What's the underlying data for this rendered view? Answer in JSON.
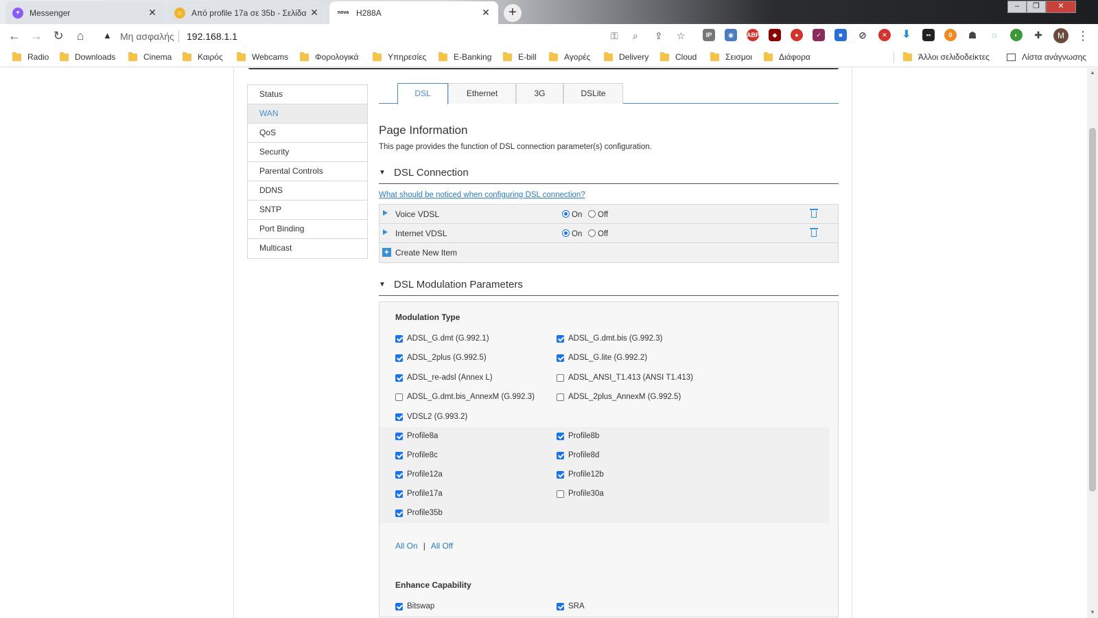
{
  "browser": {
    "tabs": [
      {
        "title": "Messenger",
        "favicon_color": "#8a5cf5",
        "active": false
      },
      {
        "title": "Από profile 17a σε 35b - Σελίδα",
        "favicon_color": "#f0b429",
        "active": false
      },
      {
        "title": "H288A",
        "favicon_text": "nova",
        "active": true
      }
    ],
    "security_label": "Μη ασφαλής",
    "url": "192.168.1.1",
    "avatar_initial": "M",
    "bookmarks": [
      "Radio",
      "Downloads",
      "Cinema",
      "Καιρός",
      "Webcams",
      "Φορολογικά",
      "Υπηρεσίες",
      "E-Banking",
      "E-bill",
      "Αγορές",
      "Delivery",
      "Cloud",
      "Σεισμοι",
      "Διάφορα"
    ],
    "other_bookmarks": "Άλλοι σελιδοδείκτες",
    "reading_list": "Λίστα ανάγνωσης"
  },
  "leftnav": {
    "items": [
      "Status",
      "WAN",
      "QoS",
      "Security",
      "Parental Controls",
      "DDNS",
      "SNTP",
      "Port Binding",
      "Multicast"
    ],
    "active": "WAN"
  },
  "content_tabs": [
    "DSL",
    "Ethernet",
    "3G",
    "DSLite"
  ],
  "page": {
    "title": "Page Information",
    "description": "This page provides the function of DSL connection parameter(s) configuration."
  },
  "dsl_connection": {
    "heading": "DSL Connection",
    "help_link": "What should be noticed when configuring DSL connection?",
    "rows": [
      {
        "name": "Voice VDSL",
        "on_label": "On",
        "off_label": "Off",
        "state": "on"
      },
      {
        "name": "Internet VDSL",
        "on_label": "On",
        "off_label": "Off",
        "state": "on"
      }
    ],
    "create_label": "Create New Item"
  },
  "modulation": {
    "heading": "DSL Modulation Parameters",
    "type_title": "Modulation Type",
    "items": [
      {
        "label": "ADSL_G.dmt (G.992.1)",
        "checked": true
      },
      {
        "label": "ADSL_G.dmt.bis (G.992.3)",
        "checked": true
      },
      {
        "label": "ADSL_2plus (G.992.5)",
        "checked": true
      },
      {
        "label": "ADSL_G.lite (G.992.2)",
        "checked": true
      },
      {
        "label": "ADSL_re-adsl (Annex L)",
        "checked": true
      },
      {
        "label": "ADSL_ANSI_T1.413 (ANSI T1.413)",
        "checked": false
      },
      {
        "label": "ADSL_G.dmt.bis_AnnexM (G.992.3)",
        "checked": false
      },
      {
        "label": "ADSL_2plus_AnnexM (G.992.5)",
        "checked": false
      },
      {
        "label": "VDSL2 (G.993.2)",
        "checked": true
      }
    ],
    "profiles": [
      {
        "label": "Profile8a",
        "checked": true
      },
      {
        "label": "Profile8b",
        "checked": true
      },
      {
        "label": "Profile8c",
        "checked": true
      },
      {
        "label": "Profile8d",
        "checked": true
      },
      {
        "label": "Profile12a",
        "checked": true
      },
      {
        "label": "Profile12b",
        "checked": true
      },
      {
        "label": "Profile17a",
        "checked": true
      },
      {
        "label": "Profile30a",
        "checked": false
      },
      {
        "label": "Profile35b",
        "checked": true
      }
    ],
    "all_on": "All On",
    "all_off": "All Off",
    "separator": "|",
    "enhance_title": "Enhance Capability",
    "enhance_items": [
      {
        "label": "Bitswap",
        "checked": true
      },
      {
        "label": "SRA",
        "checked": true
      }
    ]
  }
}
